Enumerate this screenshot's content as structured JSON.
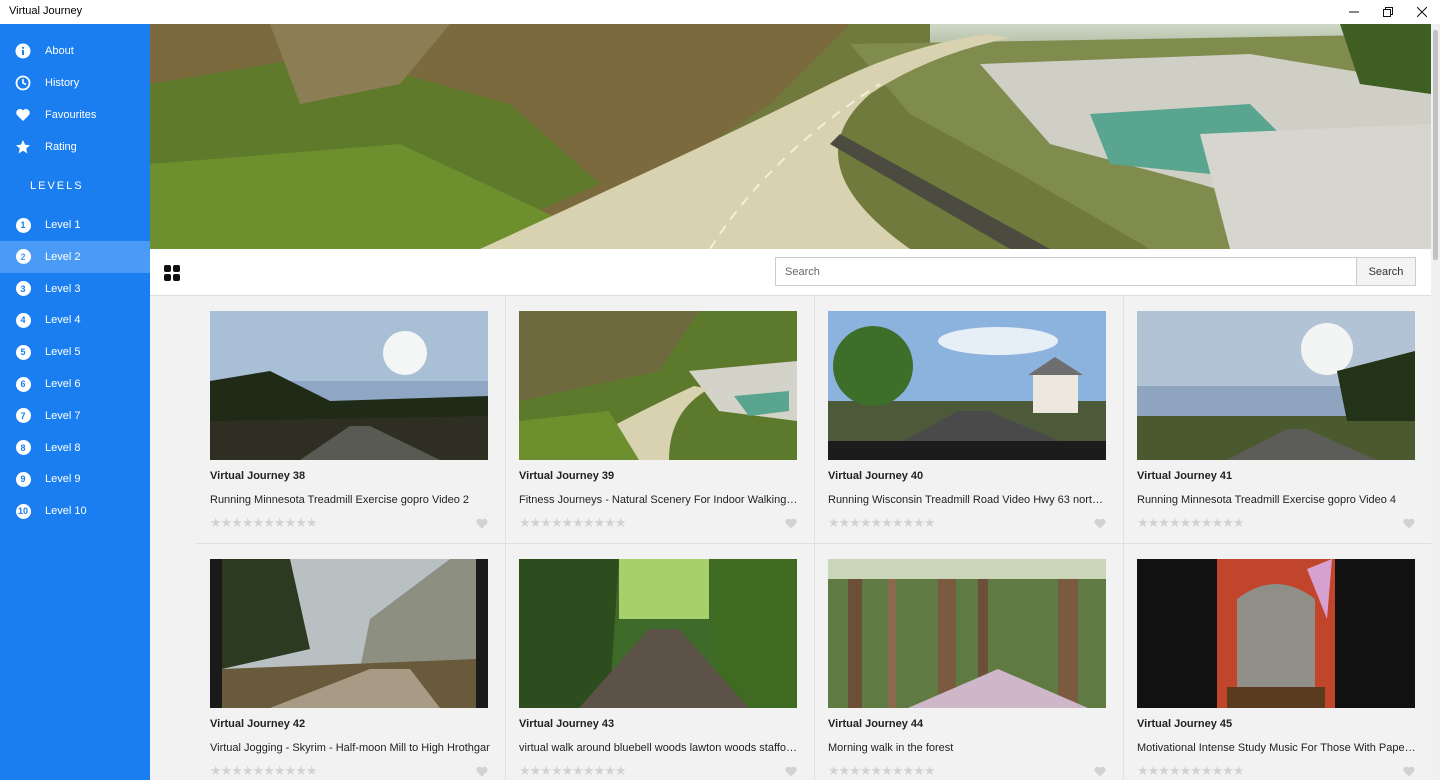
{
  "window": {
    "title": "Virtual Journey"
  },
  "sidebar": {
    "menu": [
      {
        "label": "About",
        "icon": "info-icon"
      },
      {
        "label": "History",
        "icon": "clock-icon"
      },
      {
        "label": "Favourites",
        "icon": "heart-icon"
      },
      {
        "label": "Rating",
        "icon": "star-icon"
      }
    ],
    "levels_heading": "LEVELS",
    "levels": [
      {
        "num": "1",
        "label": "Level 1",
        "active": false
      },
      {
        "num": "2",
        "label": "Level 2",
        "active": true
      },
      {
        "num": "3",
        "label": "Level 3",
        "active": false
      },
      {
        "num": "4",
        "label": "Level 4",
        "active": false
      },
      {
        "num": "5",
        "label": "Level 5",
        "active": false
      },
      {
        "num": "6",
        "label": "Level 6",
        "active": false
      },
      {
        "num": "7",
        "label": "Level 7",
        "active": false
      },
      {
        "num": "8",
        "label": "Level 8",
        "active": false
      },
      {
        "num": "9",
        "label": "Level 9",
        "active": false
      },
      {
        "num": "10",
        "label": "Level 10",
        "active": false
      }
    ]
  },
  "toolbar": {
    "view_icon": "grid-view-icon",
    "search_placeholder": "Search",
    "search_button": "Search"
  },
  "videos": [
    {
      "title": "Virtual Journey 38",
      "desc": "Running Minnesota Treadmill Exercise gopro Video 2",
      "rating": 0
    },
    {
      "title": "Virtual Journey 39",
      "desc": "Fitness Journeys - Natural Scenery For Indoor Walking Tr...",
      "rating": 0
    },
    {
      "title": "Virtual Journey 40",
      "desc": "Running Wisconsin Treadmill Road Video Hwy 63 north p...",
      "rating": 0
    },
    {
      "title": "Virtual Journey 41",
      "desc": "Running Minnesota Treadmill Exercise gopro Video 4",
      "rating": 0
    },
    {
      "title": "Virtual Journey 42",
      "desc": "Virtual Jogging - Skyrim - Half-moon Mill to High Hrothgar",
      "rating": 0
    },
    {
      "title": "Virtual Journey 43",
      "desc": "virtual walk around bluebell woods lawton woods stafford...",
      "rating": 0
    },
    {
      "title": "Virtual Journey 44",
      "desc": "Morning walk in the forest",
      "rating": 0
    },
    {
      "title": "Virtual Journey 45",
      "desc": "Motivational Intense Study Music For Those With Papers...",
      "rating": 0
    }
  ],
  "colors": {
    "sidebar": "#1a7ef0",
    "sidebar_active": "#4a9bf5",
    "star_empty": "#d2d2d2"
  }
}
